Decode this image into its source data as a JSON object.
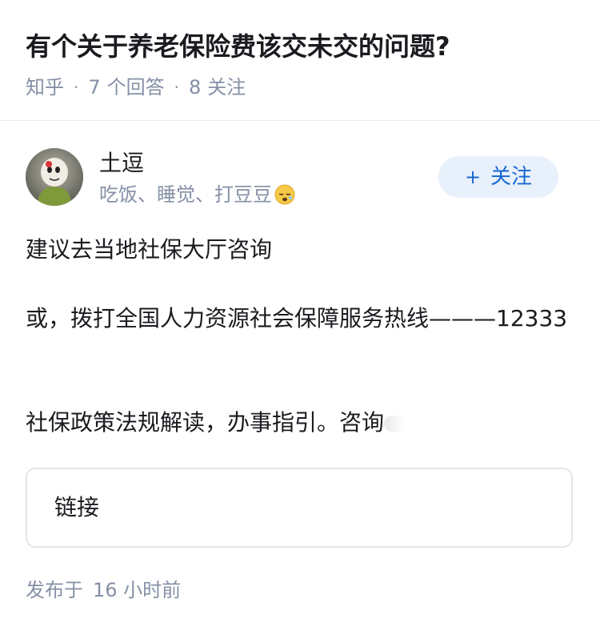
{
  "question": {
    "title": "有个关于养老保险费该交未交的问题?",
    "source": "知乎",
    "answer_count": "7",
    "answer_label": "个回答",
    "follower_count": "8",
    "follower_label": "关注"
  },
  "author": {
    "name": "土逗",
    "bio": "吃饭、睡觉、打豆豆",
    "bio_emoji": "sleeping-face-icon"
  },
  "follow_button": {
    "plus": "+",
    "label": "关注"
  },
  "answer": {
    "paragraphs": [
      "建议去当地社保大厅咨询",
      "或，拨打全国人力资源社会保障服务热线———12333",
      "社保政策法规解读，办事指引。咨询"
    ]
  },
  "link_card": {
    "label": "链接"
  },
  "footer": {
    "publish_label": "发布于",
    "publish_time": "16 小时前"
  },
  "colors": {
    "primary_text": "#191b1f",
    "secondary_text": "#8590a6",
    "accent_blue": "#1a66d2",
    "follow_bg": "#e8f1fb",
    "border": "#e4e5e9"
  }
}
